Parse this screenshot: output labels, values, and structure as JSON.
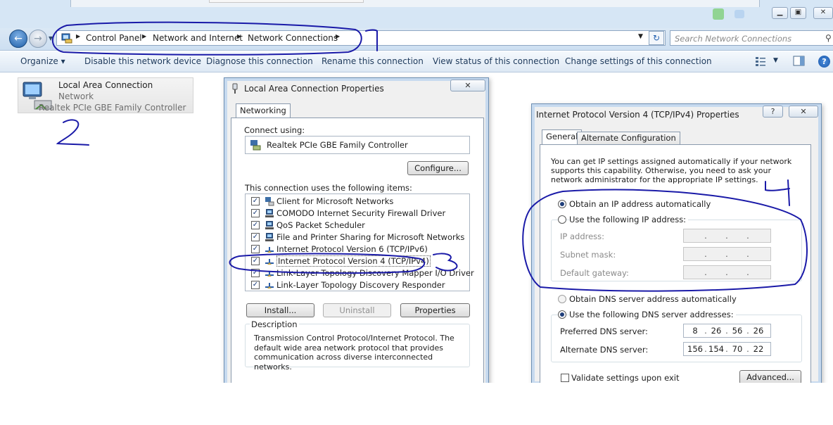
{
  "explorer": {
    "breadcrumbs": [
      "Control Panel",
      "Network and Internet",
      "Network Connections"
    ],
    "search_placeholder": "Search Network Connections",
    "toolbar": {
      "organize": "Organize",
      "disable": "Disable this network device",
      "diagnose": "Diagnose this connection",
      "rename": "Rename this connection",
      "view_status": "View status of this connection",
      "change_settings": "Change settings of this connection"
    },
    "connection": {
      "name": "Local Area Connection",
      "status": "Network",
      "device": "Realtek PCIe GBE Family Controller"
    }
  },
  "lan_properties": {
    "title": "Local Area Connection Properties",
    "tab": "Networking",
    "connect_using_label": "Connect using:",
    "adapter": "Realtek PCIe GBE Family Controller",
    "configure_button": "Configure...",
    "items_label": "This connection uses the following items:",
    "items": [
      {
        "label": "Client for Microsoft Networks",
        "checked": true,
        "icon": "network-client-icon"
      },
      {
        "label": "COMODO Internet Security Firewall Driver",
        "checked": true,
        "icon": "firewall-driver-icon"
      },
      {
        "label": "QoS Packet Scheduler",
        "checked": true,
        "icon": "service-icon"
      },
      {
        "label": "File and Printer Sharing for Microsoft Networks",
        "checked": true,
        "icon": "service-icon"
      },
      {
        "label": "Internet Protocol Version 6 (TCP/IPv6)",
        "checked": true,
        "icon": "protocol-icon"
      },
      {
        "label": "Internet Protocol Version 4 (TCP/IPv4)",
        "checked": true,
        "icon": "protocol-icon"
      },
      {
        "label": "Link-Layer Topology Discovery Mapper I/O Driver",
        "checked": true,
        "icon": "protocol-icon"
      },
      {
        "label": "Link-Layer Topology Discovery Responder",
        "checked": true,
        "icon": "protocol-icon"
      }
    ],
    "install_button": "Install...",
    "uninstall_button": "Uninstall",
    "properties_button": "Properties",
    "description_label": "Description",
    "description_text": "Transmission Control Protocol/Internet Protocol. The default wide area network protocol that provides communication across diverse interconnected networks."
  },
  "ipv4_properties": {
    "title": "Internet Protocol Version 4 (TCP/IPv4) Properties",
    "help_button": "?",
    "tabs": [
      "General",
      "Alternate Configuration"
    ],
    "intro": "You can get IP settings assigned automatically if your network supports this capability. Otherwise, you need to ask your network administrator for the appropriate IP settings.",
    "obtain_ip_auto": "Obtain an IP address automatically",
    "use_following_ip": "Use the following IP address:",
    "ip_address_label": "IP address:",
    "subnet_mask_label": "Subnet mask:",
    "default_gateway_label": "Default gateway:",
    "obtain_dns_auto": "Obtain DNS server address automatically",
    "use_following_dns": "Use the following DNS server addresses:",
    "preferred_dns_label": "Preferred DNS server:",
    "preferred_dns": [
      "8",
      "26",
      "56",
      "26"
    ],
    "alternate_dns_label": "Alternate DNS server:",
    "alternate_dns": [
      "156",
      "154",
      "70",
      "22"
    ],
    "validate_label": "Validate settings upon exit",
    "advanced_button": "Advanced...",
    "ip_selection": "obtain_auto",
    "dns_selection": "use_following"
  },
  "annotations": {
    "marks": [
      "1",
      "2",
      "3",
      "4"
    ],
    "ink_color": "#1a1aa8"
  },
  "colors": {
    "toolbar_text": "#1e3a5c",
    "accent_blue": "#1f5fa8"
  }
}
